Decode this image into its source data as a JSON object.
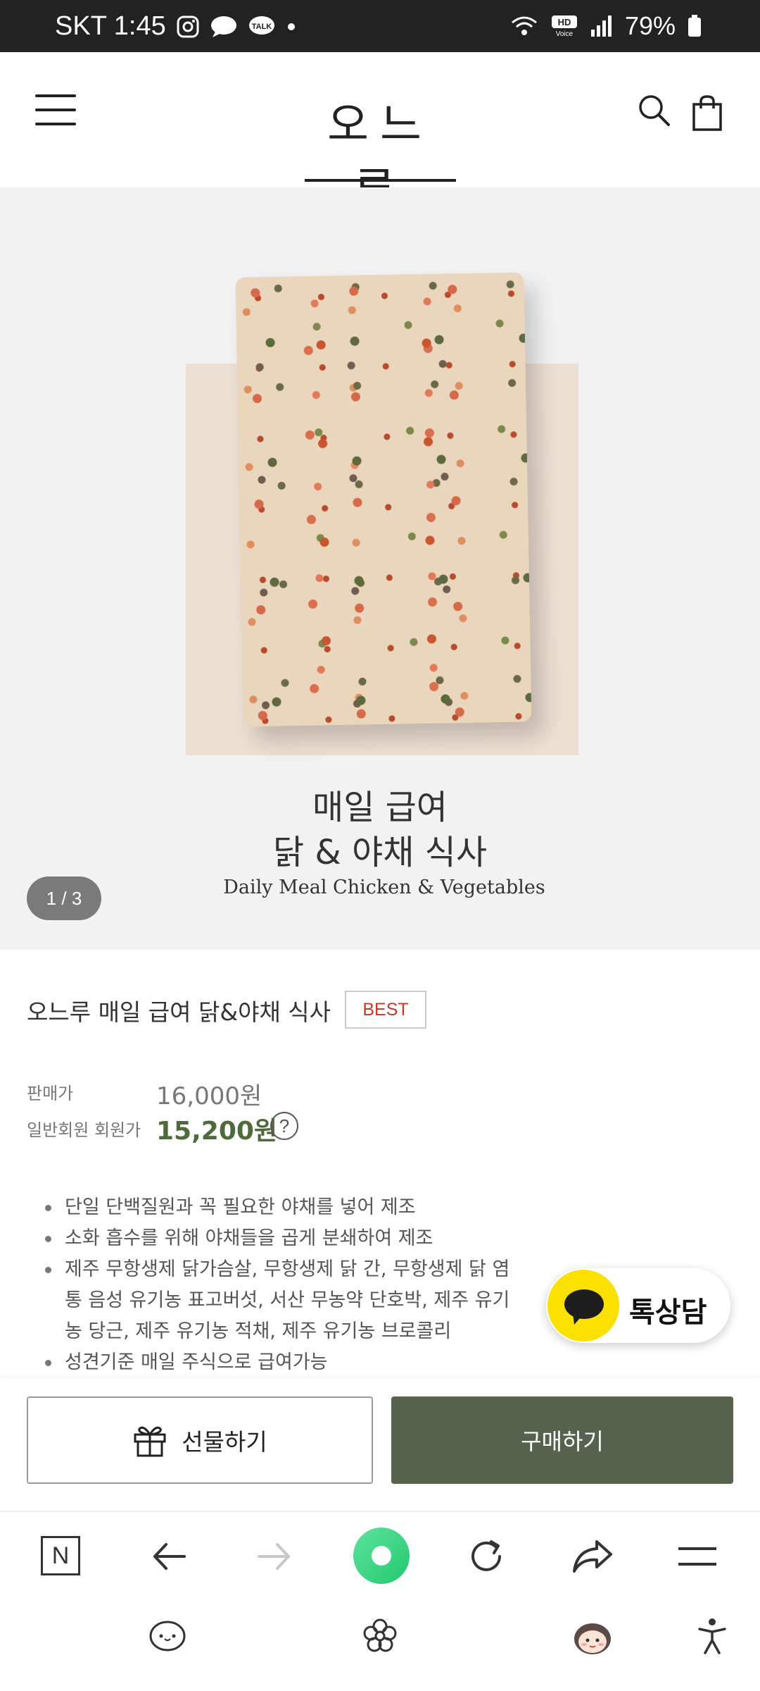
{
  "status_bar": {
    "carrier_time": "SKT 1:45",
    "battery": "79%"
  },
  "header": {
    "logo": "오느루",
    "menu_icon": "hamburger-icon",
    "search_icon": "search-icon",
    "cart_icon": "shopping-bag-icon"
  },
  "hero": {
    "title_line1": "매일 급여",
    "title_line2": "닭 & 야채 식사",
    "subtitle": "Daily Meal Chicken & Vegetables",
    "pager": "1 / 3"
  },
  "product": {
    "name": "오느루 매일 급여 닭&야채 식사",
    "badge": "BEST",
    "price_label": "판매가",
    "price": "16,000원",
    "member_price_label": "일반회원 회원가",
    "member_price": "15,200원",
    "help": "?",
    "features": [
      "단일 단백질원과 꼭 필요한 야채를 넣어 제조",
      "소화 흡수를 위해 야채들을 곱게 분쇄하여 제조",
      "제주 무항생제 닭가슴살, 무항생제 닭 간, 무항생제 닭 염통 음성 유기농 표고버섯, 서산 무농약 단호박, 제주 유기농 당근, 제주 유기농 적채, 제주 유기농 브로콜리",
      "성견기준 매일 주식으로 급여가능"
    ]
  },
  "chat": {
    "label": "톡상담"
  },
  "actions": {
    "gift_label": "선물하기",
    "buy_label": "구매하기"
  },
  "colors": {
    "accent_green": "#55634e",
    "price_green": "#4f6b3c",
    "badge_red": "#c0392b",
    "kakao_yellow": "#fae100"
  }
}
